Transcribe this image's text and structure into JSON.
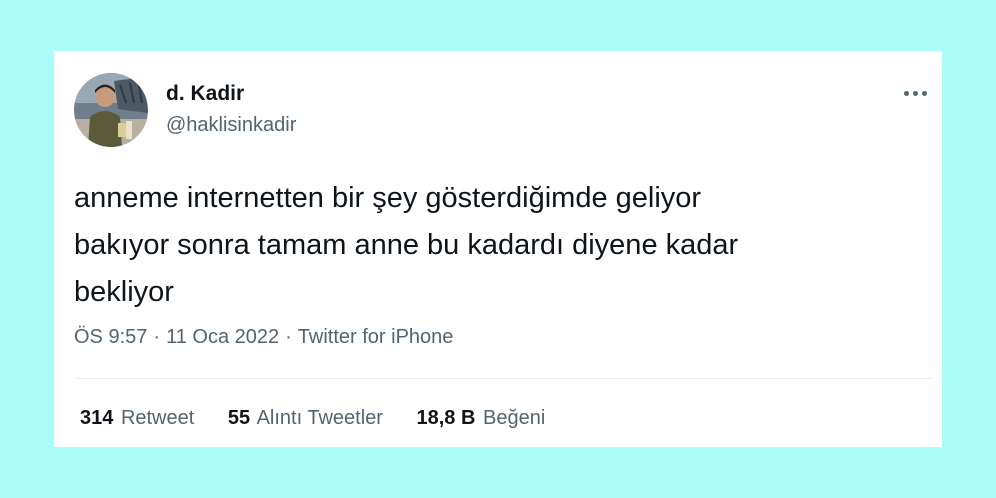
{
  "tweet": {
    "author": {
      "display_name": "d. Kadir",
      "handle": "@haklisinkadir",
      "avatar_icon": "profile-photo"
    },
    "more_icon": "more-dots-icon",
    "text": "anneme internetten bir şey gösterdiğimde geliyor\nbakıyor sonra tamam anne bu kadardı diyene kadar\nbekliyor",
    "time": "ÖS 9:57",
    "separator": "·",
    "date": "11 Oca 2022",
    "source": "Twitter for iPhone",
    "stats": [
      {
        "count": "314",
        "label": "Retweet"
      },
      {
        "count": "55",
        "label": "Alıntı Tweetler"
      },
      {
        "count": "18,8 B",
        "label": "Beğeni"
      }
    ]
  },
  "colors": {
    "page_background": "#aafbfa",
    "card_background": "#ffffff",
    "primary_text": "#0f1419",
    "secondary_text": "#536471"
  }
}
